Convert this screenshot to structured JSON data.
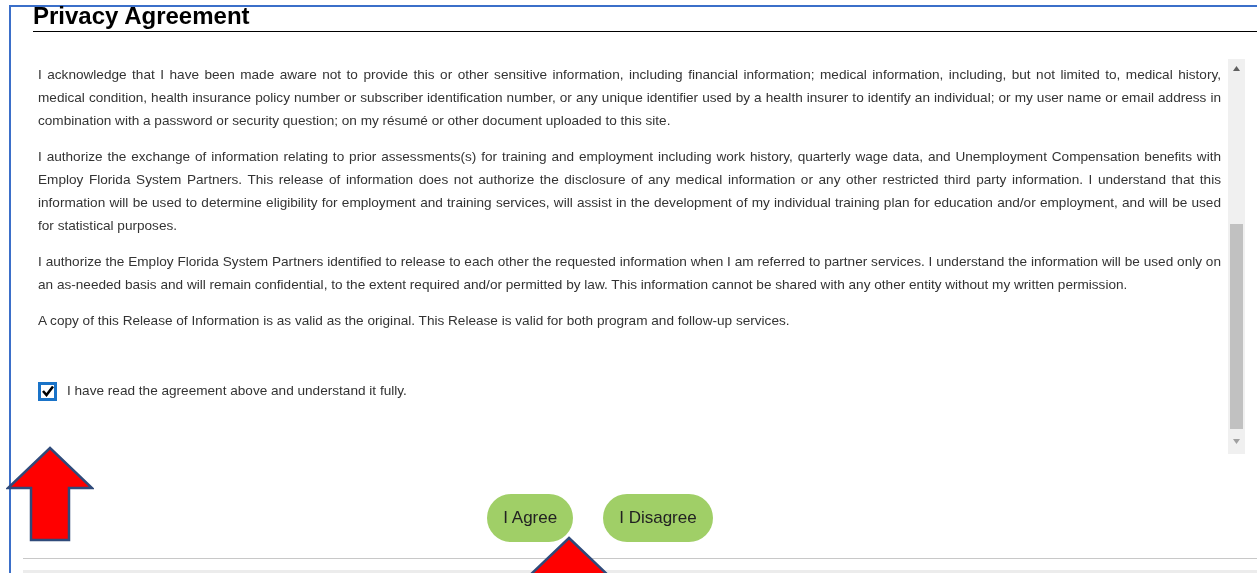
{
  "title": "Privacy Agreement",
  "paragraphs": [
    "I acknowledge that I have been made aware not to provide this or other sensitive information, including financial information; medical information, including, but not limited to, medical history, medical condition, health insurance policy number or subscriber identification number, or any unique identifier used by a health insurer to identify an individual; or my user name or email address in combination with a password or security question; on my résumé or other document uploaded to this site.",
    "I authorize the exchange of information relating to prior assessments(s) for training and employment including work history, quarterly wage data, and Unemployment Compensation benefits with Employ Florida System Partners. This release of information does not authorize the disclosure of any medical information or any other restricted third party information. I understand that this information will be used to determine eligibility for employment and training services, will assist in the development of my individual training plan for education and/or employment, and will be used for statistical purposes.",
    "I authorize the Employ Florida System Partners identified to release to each other the requested information when I am referred to partner services. I understand the information will be used only on an as-needed basis and will remain confidential, to the extent required and/or permitted by law. This information cannot be shared with any other entity without my written permission.",
    "A copy of this Release of Information is as valid as the original. This Release is valid for both program and follow-up services."
  ],
  "agreement": {
    "label": "I have read the agreement above and understand it fully.",
    "checked": true
  },
  "buttons": [
    "I Agree",
    "I Disagree"
  ]
}
